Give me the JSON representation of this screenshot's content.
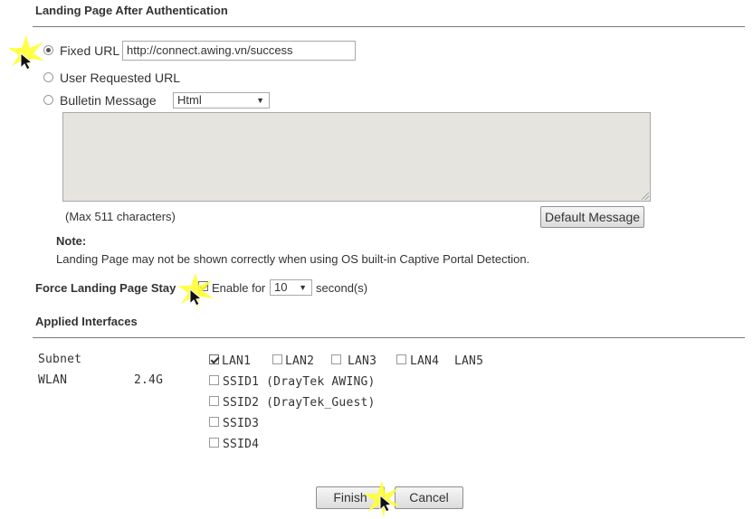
{
  "landing": {
    "title": "Landing Page After Authentication",
    "fixed_url_label": "Fixed URL",
    "fixed_url_value": "http://connect.awing.vn/success",
    "user_requested_label": "User Requested URL",
    "bulletin_label": "Bulletin Message",
    "bulletin_format": "Html",
    "max_chars": "(Max 511 characters)",
    "default_message_button": "Default Message",
    "note_title": "Note:",
    "note_text": "Landing Page may not be shown correctly when using OS built-in Captive Portal Detection."
  },
  "force_stay": {
    "label": "Force Landing Page Stay",
    "enable_label": "Enable for",
    "seconds_value": "10",
    "unit": "second(s)"
  },
  "interfaces": {
    "title": "Applied Interfaces",
    "subnet_label": "Subnet",
    "wlan_label": "WLAN",
    "band": "2.4G",
    "lan": [
      "LAN1",
      "LAN2",
      "LAN3",
      "LAN4",
      "LAN5"
    ],
    "ssids": [
      "SSID1 (DrayTek AWING)",
      "SSID2 (DrayTek_Guest)",
      "SSID3",
      "SSID4"
    ]
  },
  "actions": {
    "finish": "Finish",
    "cancel": "Cancel"
  },
  "colors": {
    "textarea_bg": "#e6e4de",
    "pointer_highlight": "#ffff33"
  }
}
